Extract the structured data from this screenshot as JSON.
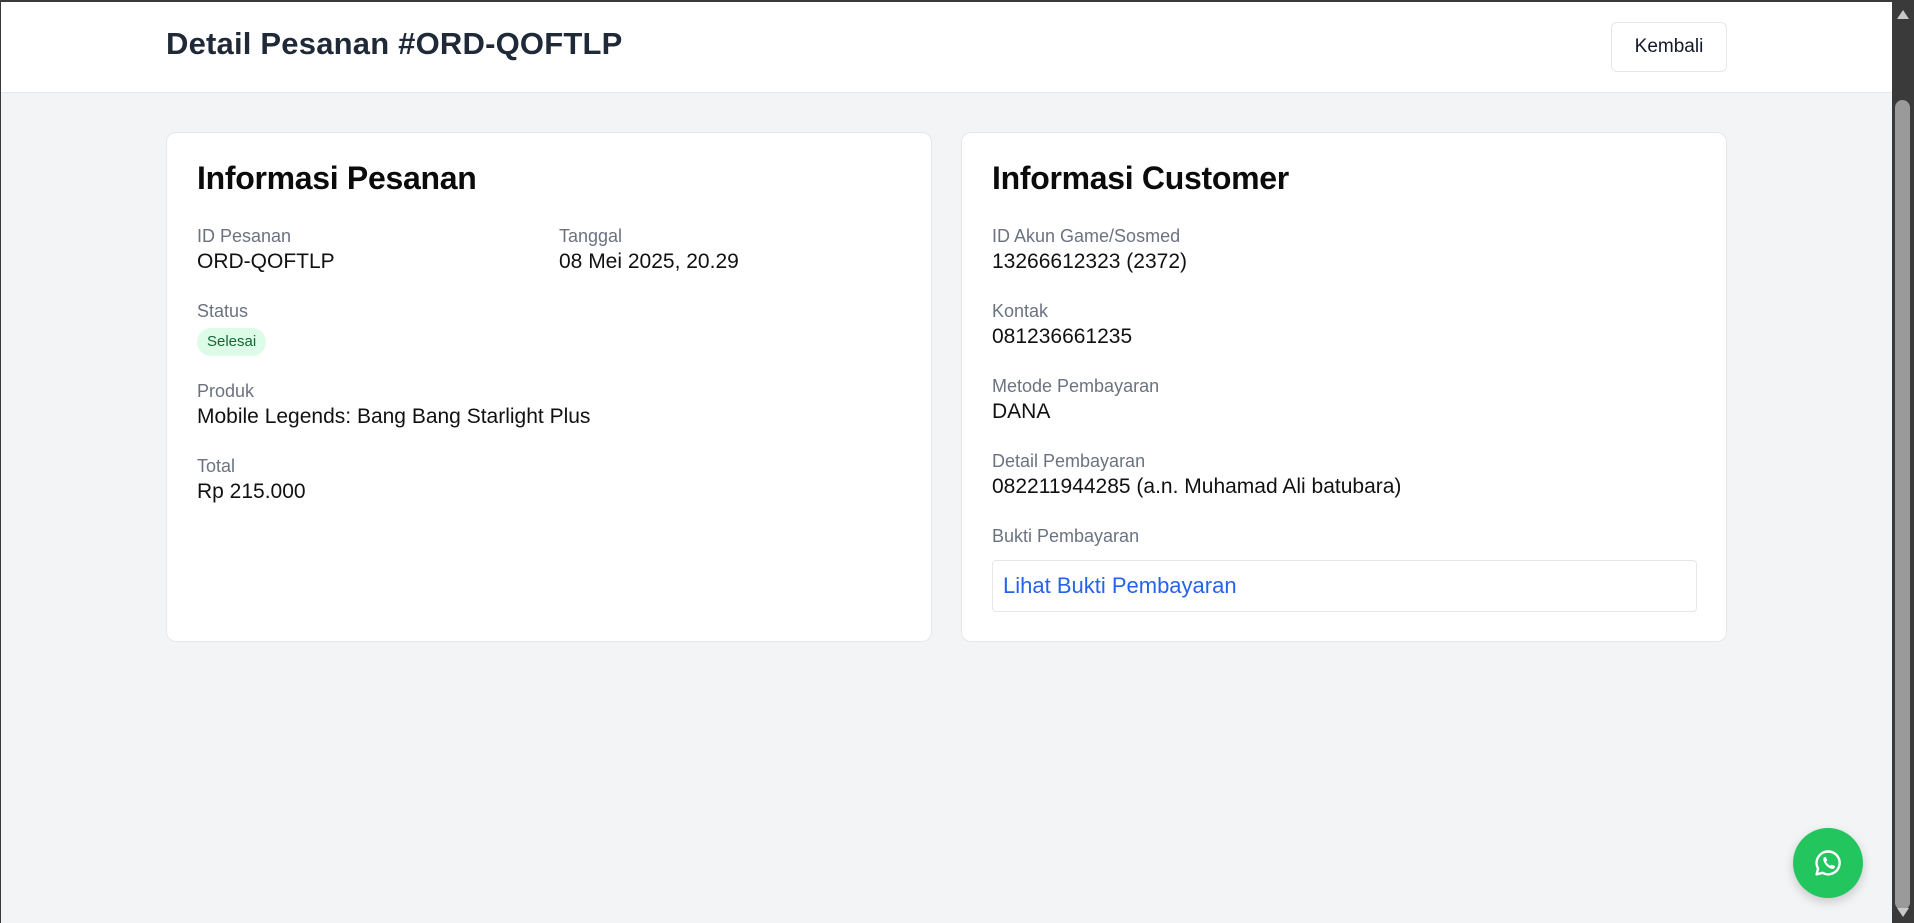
{
  "header": {
    "title": "Detail Pesanan #ORD-QOFTLP",
    "back_label": "Kembali"
  },
  "order_info": {
    "title": "Informasi Pesanan",
    "id_label": "ID Pesanan",
    "id_value": "ORD-QOFTLP",
    "date_label": "Tanggal",
    "date_value": "08 Mei 2025, 20.29",
    "status_label": "Status",
    "status_value": "Selesai",
    "product_label": "Produk",
    "product_value": "Mobile Legends: Bang Bang Starlight Plus",
    "total_label": "Total",
    "total_value": "Rp 215.000"
  },
  "customer_info": {
    "title": "Informasi Customer",
    "account_label": "ID Akun Game/Sosmed",
    "account_value": "13266612323 (2372)",
    "contact_label": "Kontak",
    "contact_value": "081236661235",
    "method_label": "Metode Pembayaran",
    "method_value": "DANA",
    "detail_label": "Detail Pembayaran",
    "detail_value": "082211944285 (a.n. Muhamad Ali batubara)",
    "proof_label": "Bukti Pembayaran",
    "proof_link": "Lihat Bukti Pembayaran"
  },
  "colors": {
    "page_bg": "#f3f4f6",
    "badge_bg": "#dcfce7",
    "badge_text": "#166534",
    "link": "#2563eb",
    "whatsapp": "#22c55e"
  },
  "icons": {
    "floating_button": "whatsapp-icon"
  }
}
